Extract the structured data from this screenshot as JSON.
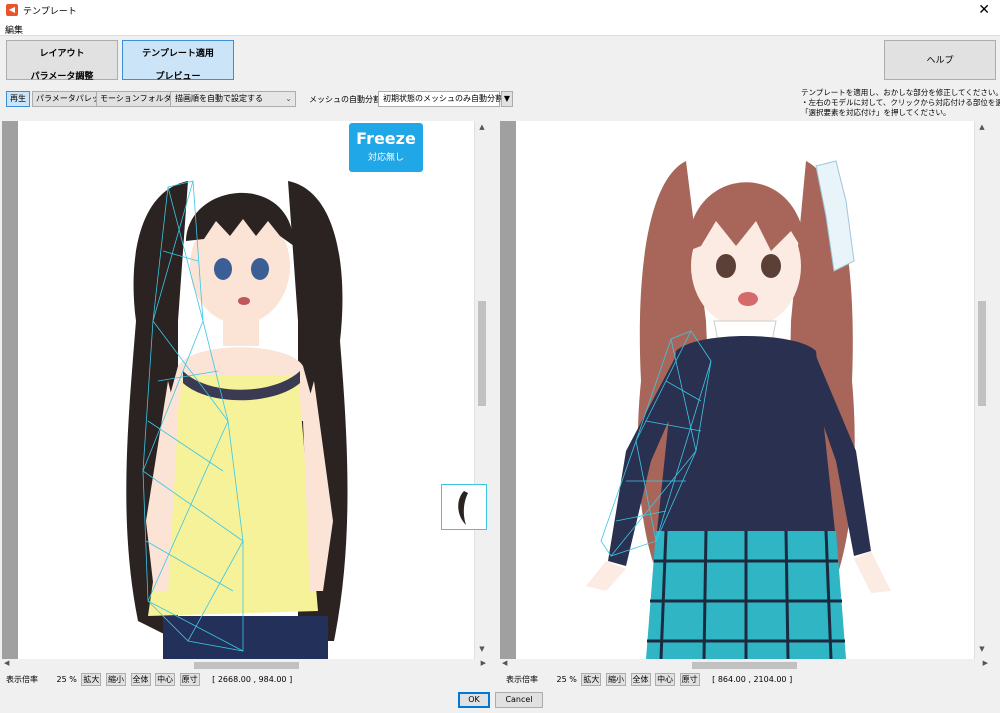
{
  "window": {
    "title": "テンプレート",
    "close": "✕"
  },
  "menu": {
    "edit": "編集"
  },
  "tabs": {
    "layout_line1": "レイアウト",
    "layout_line2": "パラメータ調整",
    "apply_line1": "テンプレート適用",
    "apply_line2": "プレビュー"
  },
  "help_button": "ヘルプ",
  "toolbar": {
    "play": "再生",
    "param_palette": "パラメータパレット",
    "motion_folder": "モーションフォルダ",
    "draw_order_select": "描画順を自動で設定する",
    "mesh_split_label": "メッシュの自動分割",
    "mesh_split_select": "初期状態のメッシュのみ自動分割"
  },
  "help_text": [
    "テンプレートを適用し、おかしな部分を修正してください。",
    "・左右のモデルに対して、クリックから対応付ける部位を選び、",
    "「選択要素を対応付け」を押してください。"
  ],
  "freeze_badge": {
    "title": "Freeze",
    "subtitle": "対応無し"
  },
  "left_status": {
    "zoom_label": "表示倍率",
    "zoom_value": "25 %",
    "zoom_in": "拡大",
    "zoom_out": "縮小",
    "fit_all": "全体",
    "center": "中心",
    "actual_size": "原寸",
    "coords": "[ 2668.00 , 984.00 ]"
  },
  "right_status": {
    "zoom_label": "表示倍率",
    "zoom_value": "25 %",
    "zoom_in": "拡大",
    "zoom_out": "縮小",
    "fit_all": "全体",
    "center": "中心",
    "actual_size": "原寸",
    "coords": "[ 864.00 , 2104.00 ]"
  },
  "footer": {
    "ok": "OK",
    "cancel": "Cancel"
  },
  "icons": {
    "app": "cubism-app-icon",
    "scroll_up": "▲",
    "scroll_down": "▼",
    "scroll_left": "◀",
    "scroll_right": "▶",
    "dropdown": "⌄"
  },
  "colors": {
    "accent": "#20a7e8",
    "mesh": "#3cc6e4",
    "active_tab": "#cce4f7"
  }
}
